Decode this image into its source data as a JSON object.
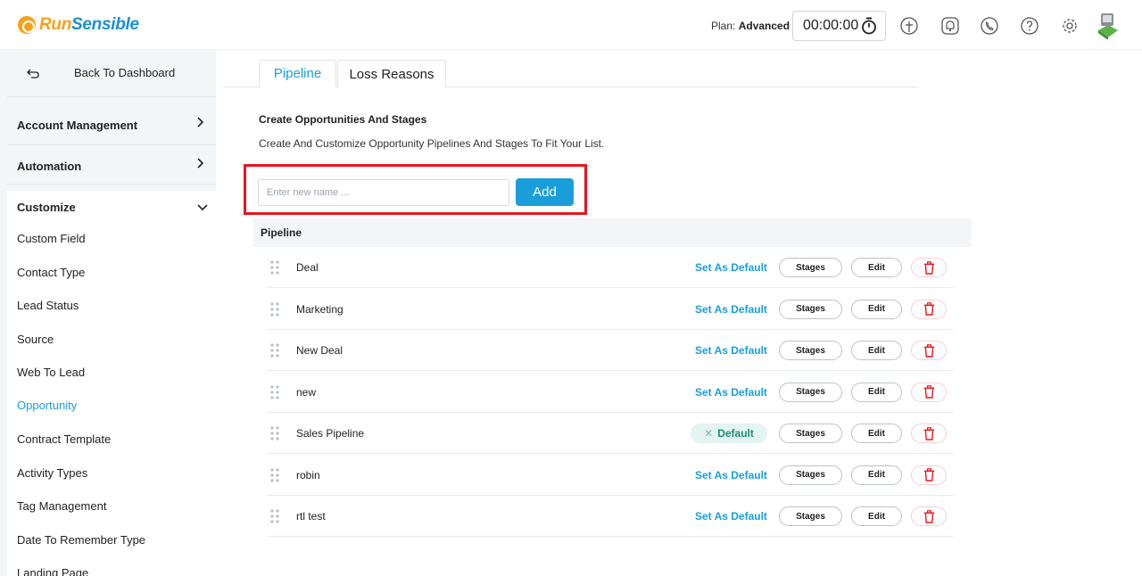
{
  "header": {
    "logo_run": "Run",
    "logo_sensible": "Sensible",
    "plan_label": "Plan:",
    "plan_value": "Advanced",
    "timer": "00:00:00",
    "icons": [
      "timer-icon",
      "add-call-icon",
      "notification-icon",
      "phone-icon",
      "help-icon",
      "settings-icon",
      "user-avatar"
    ]
  },
  "sidebar": {
    "back_label": "Back To Dashboard",
    "sections": [
      {
        "label": "Account Management",
        "state": "collapsed"
      },
      {
        "label": "Automation",
        "state": "collapsed"
      },
      {
        "label": "Customize",
        "state": "expanded"
      }
    ],
    "items": [
      {
        "label": "Custom Field",
        "active": false
      },
      {
        "label": "Contact Type",
        "active": false
      },
      {
        "label": "Lead Status",
        "active": false
      },
      {
        "label": "Source",
        "active": false
      },
      {
        "label": "Web To Lead",
        "active": false
      },
      {
        "label": "Opportunity",
        "active": true
      },
      {
        "label": "Contract Template",
        "active": false
      },
      {
        "label": "Activity Types",
        "active": false
      },
      {
        "label": "Tag Management",
        "active": false
      },
      {
        "label": "Date To Remember Type",
        "active": false
      },
      {
        "label": "Landing Page",
        "active": false
      }
    ]
  },
  "tabs": [
    {
      "label": "Pipeline",
      "active": true
    },
    {
      "label": "Loss Reasons",
      "active": false
    }
  ],
  "main": {
    "title": "Create Opportunities And Stages",
    "subtitle": "Create And Customize Opportunity Pipelines And Stages To Fit Your List.",
    "input_value": "",
    "input_placeholder": "Enter new name ...",
    "add_label": "Add",
    "list_header": "Pipeline"
  },
  "pipelines": [
    {
      "name": "Deal",
      "is_default": false
    },
    {
      "name": "Marketing",
      "is_default": false
    },
    {
      "name": "New Deal",
      "is_default": false
    },
    {
      "name": "new",
      "is_default": false
    },
    {
      "name": "Sales Pipeline",
      "is_default": true
    },
    {
      "name": "robin",
      "is_default": false
    },
    {
      "name": "rtl test",
      "is_default": false
    }
  ],
  "row_actions": {
    "set_default_label": "Set As Default",
    "default_badge_label": "Default",
    "stages_label": "Stages",
    "edit_label": "Edit"
  },
  "colors": {
    "accent": "#1a9ed9",
    "logo_orange": "#f6a21a",
    "delete_red": "#e8141c",
    "default_green": "#1d8f75",
    "highlight": "#e8141c"
  }
}
